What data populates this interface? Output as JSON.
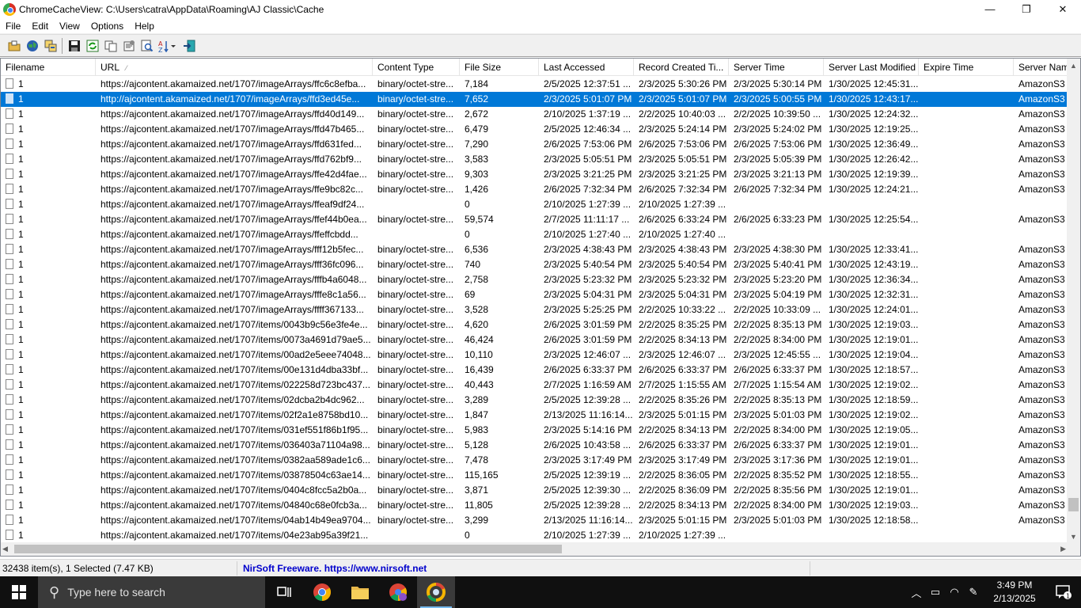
{
  "window": {
    "title": "ChromeCacheView:  C:\\Users\\catra\\AppData\\Roaming\\AJ Classic\\Cache",
    "minimize": "—",
    "maximize": "❐",
    "close": "✕"
  },
  "menu": [
    "File",
    "Edit",
    "View",
    "Options",
    "Help"
  ],
  "toolbar_icons": [
    "open-folder-icon",
    "web-icon",
    "copy-cache-icon",
    "save-icon",
    "refresh-icon",
    "copy-icon",
    "properties-icon",
    "find-icon",
    "sort-icon",
    "exit-icon"
  ],
  "columns": [
    "Filename",
    "URL",
    "Content Type",
    "File Size",
    "Last Accessed",
    "Record Created Ti...",
    "Server Time",
    "Server Last Modified",
    "Expire Time",
    "Server Nam"
  ],
  "rows": [
    [
      "1",
      "https://ajcontent.akamaized.net/1707/imageArrays/ffc6c8efba...",
      "binary/octet-stre...",
      "7,184",
      "2/5/2025 12:37:51 ...",
      "2/3/2025 5:30:26 PM",
      "2/3/2025 5:30:14 PM",
      "1/30/2025 12:45:31...",
      "",
      "AmazonS3"
    ],
    [
      "1",
      "http://ajcontent.akamaized.net/1707/imageArrays/ffd3ed45e...",
      "binary/octet-stre...",
      "7,652",
      "2/3/2025 5:01:07 PM",
      "2/3/2025 5:01:07 PM",
      "2/3/2025 5:00:55 PM",
      "1/30/2025 12:43:17...",
      "",
      "AmazonS3"
    ],
    [
      "1",
      "https://ajcontent.akamaized.net/1707/imageArrays/ffd40d149...",
      "binary/octet-stre...",
      "2,672",
      "2/10/2025 1:37:19 ...",
      "2/2/2025 10:40:03 ...",
      "2/2/2025 10:39:50 ...",
      "1/30/2025 12:24:32...",
      "",
      "AmazonS3"
    ],
    [
      "1",
      "https://ajcontent.akamaized.net/1707/imageArrays/ffd47b465...",
      "binary/octet-stre...",
      "6,479",
      "2/5/2025 12:46:34 ...",
      "2/3/2025 5:24:14 PM",
      "2/3/2025 5:24:02 PM",
      "1/30/2025 12:19:25...",
      "",
      "AmazonS3"
    ],
    [
      "1",
      "https://ajcontent.akamaized.net/1707/imageArrays/ffd631fed...",
      "binary/octet-stre...",
      "7,290",
      "2/6/2025 7:53:06 PM",
      "2/6/2025 7:53:06 PM",
      "2/6/2025 7:53:06 PM",
      "1/30/2025 12:36:49...",
      "",
      "AmazonS3"
    ],
    [
      "1",
      "https://ajcontent.akamaized.net/1707/imageArrays/ffd762bf9...",
      "binary/octet-stre...",
      "3,583",
      "2/3/2025 5:05:51 PM",
      "2/3/2025 5:05:51 PM",
      "2/3/2025 5:05:39 PM",
      "1/30/2025 12:26:42...",
      "",
      "AmazonS3"
    ],
    [
      "1",
      "https://ajcontent.akamaized.net/1707/imageArrays/ffe42d4fae...",
      "binary/octet-stre...",
      "9,303",
      "2/3/2025 3:21:25 PM",
      "2/3/2025 3:21:25 PM",
      "2/3/2025 3:21:13 PM",
      "1/30/2025 12:19:39...",
      "",
      "AmazonS3"
    ],
    [
      "1",
      "https://ajcontent.akamaized.net/1707/imageArrays/ffe9bc82c...",
      "binary/octet-stre...",
      "1,426",
      "2/6/2025 7:32:34 PM",
      "2/6/2025 7:32:34 PM",
      "2/6/2025 7:32:34 PM",
      "1/30/2025 12:24:21...",
      "",
      "AmazonS3"
    ],
    [
      "1",
      "https://ajcontent.akamaized.net/1707/imageArrays/ffeaf9df24...",
      "",
      "0",
      "2/10/2025 1:27:39 ...",
      "2/10/2025 1:27:39 ...",
      "",
      "",
      "",
      ""
    ],
    [
      "1",
      "https://ajcontent.akamaized.net/1707/imageArrays/ffef44b0ea...",
      "binary/octet-stre...",
      "59,574",
      "2/7/2025 11:11:17 ...",
      "2/6/2025 6:33:24 PM",
      "2/6/2025 6:33:23 PM",
      "1/30/2025 12:25:54...",
      "",
      "AmazonS3"
    ],
    [
      "1",
      "https://ajcontent.akamaized.net/1707/imageArrays/ffeffcbdd...",
      "",
      "0",
      "2/10/2025 1:27:40 ...",
      "2/10/2025 1:27:40 ...",
      "",
      "",
      "",
      ""
    ],
    [
      "1",
      "https://ajcontent.akamaized.net/1707/imageArrays/fff12b5fec...",
      "binary/octet-stre...",
      "6,536",
      "2/3/2025 4:38:43 PM",
      "2/3/2025 4:38:43 PM",
      "2/3/2025 4:38:30 PM",
      "1/30/2025 12:33:41...",
      "",
      "AmazonS3"
    ],
    [
      "1",
      "https://ajcontent.akamaized.net/1707/imageArrays/fff36fc096...",
      "binary/octet-stre...",
      "740",
      "2/3/2025 5:40:54 PM",
      "2/3/2025 5:40:54 PM",
      "2/3/2025 5:40:41 PM",
      "1/30/2025 12:43:19...",
      "",
      "AmazonS3"
    ],
    [
      "1",
      "https://ajcontent.akamaized.net/1707/imageArrays/fffb4a6048...",
      "binary/octet-stre...",
      "2,758",
      "2/3/2025 5:23:32 PM",
      "2/3/2025 5:23:32 PM",
      "2/3/2025 5:23:20 PM",
      "1/30/2025 12:36:34...",
      "",
      "AmazonS3"
    ],
    [
      "1",
      "https://ajcontent.akamaized.net/1707/imageArrays/fffe8c1a56...",
      "binary/octet-stre...",
      "69",
      "2/3/2025 5:04:31 PM",
      "2/3/2025 5:04:31 PM",
      "2/3/2025 5:04:19 PM",
      "1/30/2025 12:32:31...",
      "",
      "AmazonS3"
    ],
    [
      "1",
      "https://ajcontent.akamaized.net/1707/imageArrays/ffff367133...",
      "binary/octet-stre...",
      "3,528",
      "2/3/2025 5:25:25 PM",
      "2/2/2025 10:33:22 ...",
      "2/2/2025 10:33:09 ...",
      "1/30/2025 12:24:01...",
      "",
      "AmazonS3"
    ],
    [
      "1",
      "https://ajcontent.akamaized.net/1707/items/0043b9c56e3fe4e...",
      "binary/octet-stre...",
      "4,620",
      "2/6/2025 3:01:59 PM",
      "2/2/2025 8:35:25 PM",
      "2/2/2025 8:35:13 PM",
      "1/30/2025 12:19:03...",
      "",
      "AmazonS3"
    ],
    [
      "1",
      "https://ajcontent.akamaized.net/1707/items/0073a4691d79ae5...",
      "binary/octet-stre...",
      "46,424",
      "2/6/2025 3:01:59 PM",
      "2/2/2025 8:34:13 PM",
      "2/2/2025 8:34:00 PM",
      "1/30/2025 12:19:01...",
      "",
      "AmazonS3"
    ],
    [
      "1",
      "https://ajcontent.akamaized.net/1707/items/00ad2e5eee74048...",
      "binary/octet-stre...",
      "10,110",
      "2/3/2025 12:46:07 ...",
      "2/3/2025 12:46:07 ...",
      "2/3/2025 12:45:55 ...",
      "1/30/2025 12:19:04...",
      "",
      "AmazonS3"
    ],
    [
      "1",
      "https://ajcontent.akamaized.net/1707/items/00e131d4dba33bf...",
      "binary/octet-stre...",
      "16,439",
      "2/6/2025 6:33:37 PM",
      "2/6/2025 6:33:37 PM",
      "2/6/2025 6:33:37 PM",
      "1/30/2025 12:18:57...",
      "",
      "AmazonS3"
    ],
    [
      "1",
      "https://ajcontent.akamaized.net/1707/items/022258d723bc437...",
      "binary/octet-stre...",
      "40,443",
      "2/7/2025 1:16:59 AM",
      "2/7/2025 1:15:55 AM",
      "2/7/2025 1:15:54 AM",
      "1/30/2025 12:19:02...",
      "",
      "AmazonS3"
    ],
    [
      "1",
      "https://ajcontent.akamaized.net/1707/items/02dcba2b4dc962...",
      "binary/octet-stre...",
      "3,289",
      "2/5/2025 12:39:28 ...",
      "2/2/2025 8:35:26 PM",
      "2/2/2025 8:35:13 PM",
      "1/30/2025 12:18:59...",
      "",
      "AmazonS3"
    ],
    [
      "1",
      "https://ajcontent.akamaized.net/1707/items/02f2a1e8758bd10...",
      "binary/octet-stre...",
      "1,847",
      "2/13/2025 11:16:14...",
      "2/3/2025 5:01:15 PM",
      "2/3/2025 5:01:03 PM",
      "1/30/2025 12:19:02...",
      "",
      "AmazonS3"
    ],
    [
      "1",
      "https://ajcontent.akamaized.net/1707/items/031ef551f86b1f95...",
      "binary/octet-stre...",
      "5,983",
      "2/3/2025 5:14:16 PM",
      "2/2/2025 8:34:13 PM",
      "2/2/2025 8:34:00 PM",
      "1/30/2025 12:19:05...",
      "",
      "AmazonS3"
    ],
    [
      "1",
      "https://ajcontent.akamaized.net/1707/items/036403a71104a98...",
      "binary/octet-stre...",
      "5,128",
      "2/6/2025 10:43:58 ...",
      "2/6/2025 6:33:37 PM",
      "2/6/2025 6:33:37 PM",
      "1/30/2025 12:19:01...",
      "",
      "AmazonS3"
    ],
    [
      "1",
      "https://ajcontent.akamaized.net/1707/items/0382aa589ade1c6...",
      "binary/octet-stre...",
      "7,478",
      "2/3/2025 3:17:49 PM",
      "2/3/2025 3:17:49 PM",
      "2/3/2025 3:17:36 PM",
      "1/30/2025 12:19:01...",
      "",
      "AmazonS3"
    ],
    [
      "1",
      "https://ajcontent.akamaized.net/1707/items/03878504c63ae14...",
      "binary/octet-stre...",
      "115,165",
      "2/5/2025 12:39:19 ...",
      "2/2/2025 8:36:05 PM",
      "2/2/2025 8:35:52 PM",
      "1/30/2025 12:18:55...",
      "",
      "AmazonS3"
    ],
    [
      "1",
      "https://ajcontent.akamaized.net/1707/items/0404c8fcc5a2b0a...",
      "binary/octet-stre...",
      "3,871",
      "2/5/2025 12:39:30 ...",
      "2/2/2025 8:36:09 PM",
      "2/2/2025 8:35:56 PM",
      "1/30/2025 12:19:01...",
      "",
      "AmazonS3"
    ],
    [
      "1",
      "https://ajcontent.akamaized.net/1707/items/04840c68e0fcb3a...",
      "binary/octet-stre...",
      "11,805",
      "2/5/2025 12:39:28 ...",
      "2/2/2025 8:34:13 PM",
      "2/2/2025 8:34:00 PM",
      "1/30/2025 12:19:03...",
      "",
      "AmazonS3"
    ],
    [
      "1",
      "https://ajcontent.akamaized.net/1707/items/04ab14b49ea9704...",
      "binary/octet-stre...",
      "3,299",
      "2/13/2025 11:16:14...",
      "2/3/2025 5:01:15 PM",
      "2/3/2025 5:01:03 PM",
      "1/30/2025 12:18:58...",
      "",
      "AmazonS3"
    ],
    [
      "1",
      "https://ajcontent.akamaized.net/1707/items/04e23ab95a39f21...",
      "",
      "0",
      "2/10/2025 1:27:39 ...",
      "2/10/2025 1:27:39 ...",
      "",
      "",
      "",
      ""
    ]
  ],
  "selected_row": 1,
  "status": {
    "count": "32438 item(s), 1 Selected  (7.47 KB)",
    "link": "NirSoft Freeware. https://www.nirsoft.net"
  },
  "taskbar": {
    "search_placeholder": "Type here to search",
    "time": "3:49 PM",
    "date": "2/13/2025",
    "notification_count": "1"
  },
  "colors": {
    "selection": "#0078d7",
    "link": "#0000cc",
    "taskbar": "#101010"
  }
}
